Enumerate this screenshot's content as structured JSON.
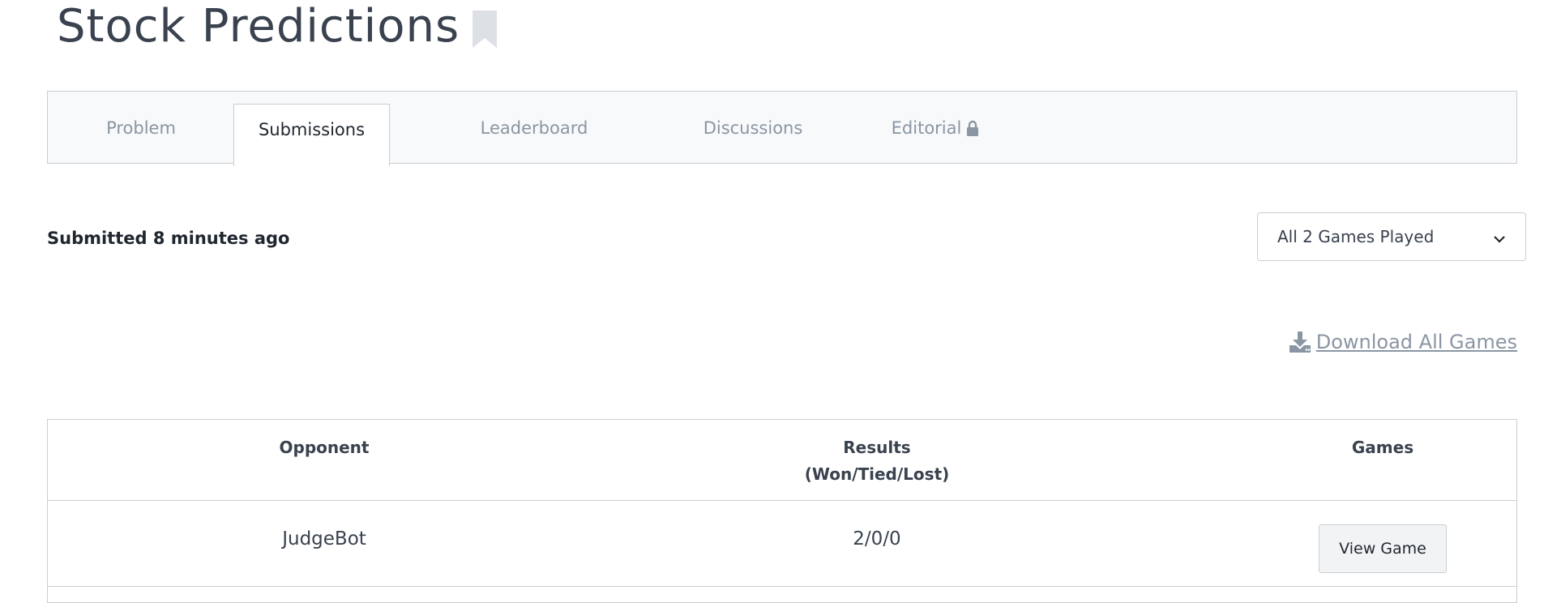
{
  "page": {
    "title": "Stock Predictions"
  },
  "tabs": [
    {
      "label": "Problem",
      "active": false
    },
    {
      "label": "Submissions",
      "active": true
    },
    {
      "label": "Leaderboard",
      "active": false
    },
    {
      "label": "Discussions",
      "active": false
    },
    {
      "label": "Editorial",
      "active": false,
      "icon": "lock-icon"
    }
  ],
  "submission": {
    "status_text": "Submitted 8 minutes ago"
  },
  "games_filter": {
    "selected": "All 2 Games Played"
  },
  "download": {
    "label": "Download All Games",
    "icon": "download-icon"
  },
  "table": {
    "headers": {
      "opponent": "Opponent",
      "results": "Results",
      "results_sub": "(Won/Tied/Lost)",
      "games": "Games"
    },
    "rows": [
      {
        "opponent": "JudgeBot",
        "results": "2/0/0",
        "action": "View Game"
      }
    ]
  },
  "colors": {
    "text": "#39424e",
    "muted": "#8a96a3",
    "border": "#c9ced4",
    "tab_bg": "#f8f9fa"
  }
}
